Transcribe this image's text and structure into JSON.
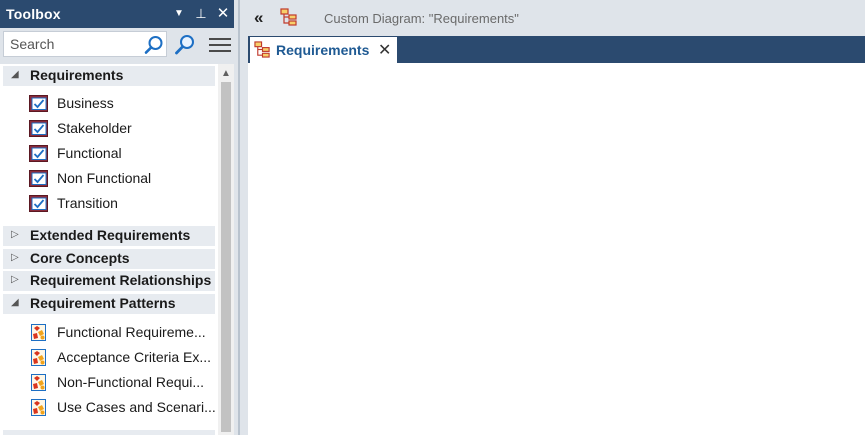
{
  "toolbox": {
    "title": "Toolbox",
    "dropdown_glyph": "▼",
    "pin_glyph": "⊥",
    "close_glyph": "✕",
    "search_placeholder": "Search",
    "categories": [
      {
        "label": "Requirements",
        "expanded": true,
        "arrow": "◢",
        "items": [
          "Business",
          "Stakeholder",
          "Functional",
          "Non Functional",
          "Transition"
        ]
      },
      {
        "label": "Extended Requirements",
        "expanded": false,
        "arrow": "▷",
        "items": []
      },
      {
        "label": "Core Concepts",
        "expanded": false,
        "arrow": "▷",
        "items": []
      },
      {
        "label": "Requirement Relationships",
        "expanded": false,
        "arrow": "▷",
        "items": []
      },
      {
        "label": "Requirement Patterns",
        "expanded": true,
        "arrow": "◢",
        "items": [
          "Functional Requireme...",
          "Acceptance Criteria Ex...",
          "Non-Functional Requi...",
          "Use Cases and Scenari..."
        ]
      }
    ],
    "scroll_up_glyph": "▲"
  },
  "document": {
    "collapse_glyph": "«",
    "title": "Custom Diagram: \"Requirements\"",
    "tab": {
      "label": "Requirements",
      "close_glyph": "✕"
    }
  },
  "icons": {
    "requirement": "requirement-icon",
    "pattern": "pattern-icon",
    "diagram": "diagram-icon"
  },
  "colors": {
    "header_bg": "#2b4a6f",
    "panel_bg": "#dfe4ea",
    "category_bg": "#e7ebf0",
    "tab_label": "#1f5a93",
    "accent": "#1d6fc4"
  }
}
